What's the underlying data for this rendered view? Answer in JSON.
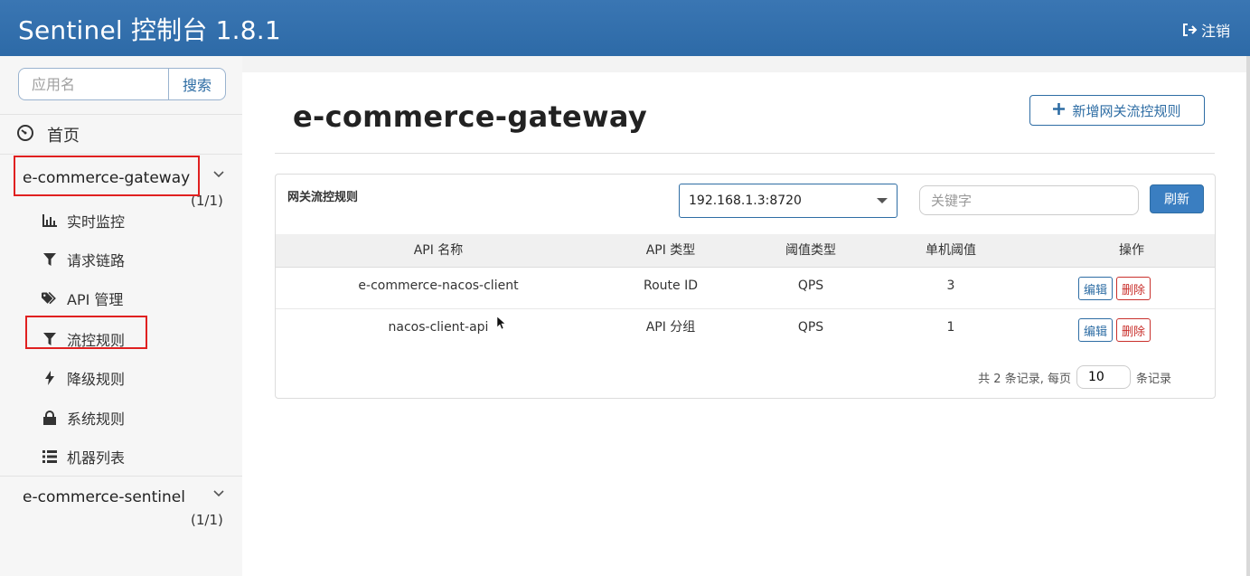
{
  "header": {
    "brand": "Sentinel 控制台 1.8.1",
    "logout_label": "注销",
    "color": "#2e6da4"
  },
  "sidebar": {
    "search_placeholder": "应用名",
    "search_button": "搜索",
    "home_label": "首页",
    "apps": [
      {
        "name": "e-commerce-gateway",
        "count": "(1/1)",
        "highlighted": true
      },
      {
        "name": "e-commerce-sentinel",
        "count": "(1/1)",
        "highlighted": false
      }
    ],
    "items": [
      {
        "label": "实时监控",
        "icon": "bar-chart-icon"
      },
      {
        "label": "请求链路",
        "icon": "filter-icon"
      },
      {
        "label": "API 管理",
        "icon": "tags-icon"
      },
      {
        "label": "流控规则",
        "icon": "filter-icon",
        "highlighted": true
      },
      {
        "label": "降级规则",
        "icon": "flash-icon"
      },
      {
        "label": "系统规则",
        "icon": "lock-icon"
      },
      {
        "label": "机器列表",
        "icon": "list-icon"
      }
    ]
  },
  "main": {
    "title": "e-commerce-gateway",
    "add_button": "新增网关流控规则",
    "panel": {
      "title": "网关流控规则",
      "selected_machine": "192.168.1.3:8720",
      "keyword_placeholder": "关键字",
      "refresh_label": "刷新",
      "columns": [
        "API 名称",
        "API 类型",
        "阈值类型",
        "单机阈值",
        "操作"
      ],
      "rows": [
        {
          "api_name": "e-commerce-nacos-client",
          "api_type": "Route ID",
          "threshold_type": "QPS",
          "threshold": "3",
          "edit": "编辑",
          "delete": "删除"
        },
        {
          "api_name": "nacos-client-api",
          "api_type": "API 分组",
          "threshold_type": "QPS",
          "threshold": "1",
          "edit": "编辑",
          "delete": "删除"
        }
      ],
      "pager_prefix": "共 2 条记录, 每页",
      "page_size": "10",
      "pager_suffix": "条记录"
    }
  }
}
